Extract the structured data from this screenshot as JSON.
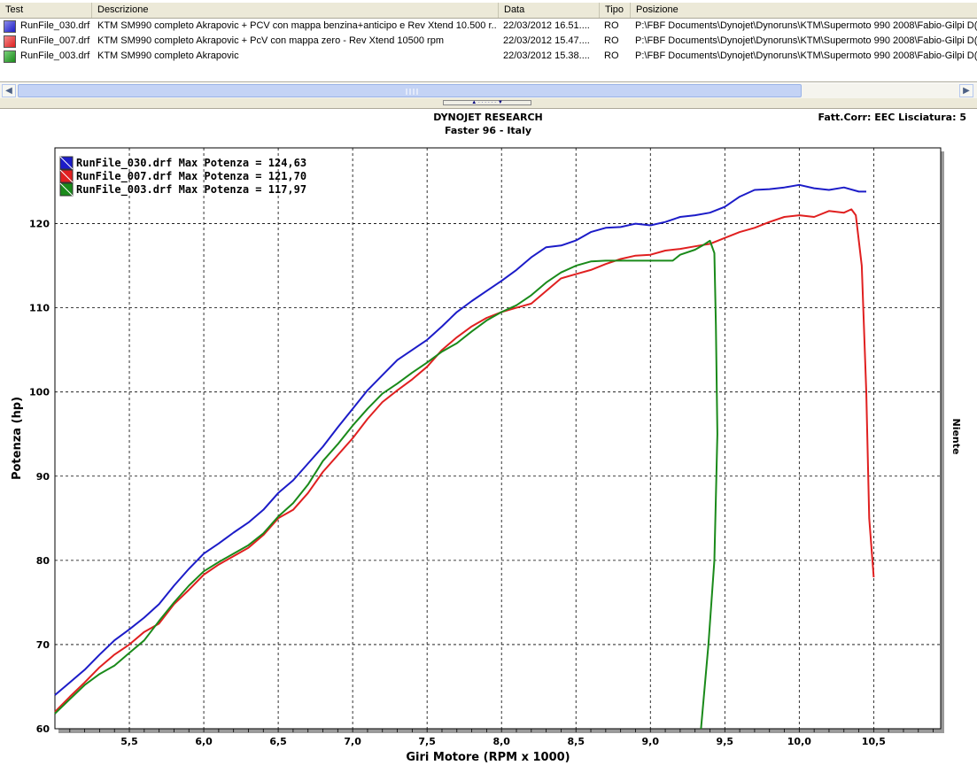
{
  "table": {
    "columns": [
      "Test",
      "Descrizione",
      "Data",
      "Tipo",
      "Posizione"
    ],
    "rows": [
      {
        "test": "RunFile_030.drf",
        "descrizione": "KTM SM990 completo Akrapovic + PCV con mappa benzina+anticipo e Rev Xtend 10.500 r...",
        "data": "22/03/2012 16.51....",
        "tipo": "RO",
        "posizione": "P:\\FBF Documents\\Dynojet\\Dynoruns\\KTM\\Supermoto 990 2008\\Fabio-Gilpi D(",
        "color": "#1c1cc8"
      },
      {
        "test": "RunFile_007.drf",
        "descrizione": "KTM SM990 completo Akrapovic + PcV con mappa zero - Rev Xtend 10500 rpm",
        "data": "22/03/2012 15.47....",
        "tipo": "RO",
        "posizione": "P:\\FBF Documents\\Dynojet\\Dynoruns\\KTM\\Supermoto 990 2008\\Fabio-Gilpi D(",
        "color": "#e02020"
      },
      {
        "test": "RunFile_003.drf",
        "descrizione": "KTM SM990 completo Akrapovic",
        "data": "22/03/2012 15.38....",
        "tipo": "RO",
        "posizione": "P:\\FBF Documents\\Dynojet\\Dynoruns\\KTM\\Supermoto 990 2008\\Fabio-Gilpi D(",
        "color": "#1a8a1a"
      }
    ]
  },
  "scrollbar": {
    "left_icon": "chevron-left-icon",
    "right_icon": "chevron-right-icon"
  },
  "graph": {
    "title_line1": "DYNOJET RESEARCH",
    "title_line2": "Faster 96 - Italy",
    "corr_label": "Fatt.Corr: EEC  Lisciatura: 5",
    "right_label": "Niente"
  },
  "chart_data": {
    "type": "line",
    "xlabel": "Giri Motore (RPM x 1000)",
    "ylabel": "Potenza (hp)",
    "xlim": [
      5.0,
      10.95
    ],
    "ylim": [
      60,
      129
    ],
    "xticks": [
      "5,5",
      "6,0",
      "6,5",
      "7,0",
      "7,5",
      "8,0",
      "8,5",
      "9,0",
      "9,5",
      "10,0",
      "10,5"
    ],
    "xtick_values": [
      5.5,
      6.0,
      6.5,
      7.0,
      7.5,
      8.0,
      8.5,
      9.0,
      9.5,
      10.0,
      10.5
    ],
    "yticks": [
      "60",
      "70",
      "80",
      "90",
      "100",
      "110",
      "120"
    ],
    "ytick_values": [
      60,
      70,
      80,
      90,
      100,
      110,
      120
    ],
    "grid": true,
    "legend_position": "top-left",
    "series": [
      {
        "name": "RunFile_030.drf",
        "legend": "RunFile_030.drf Max Potenza = 124,63",
        "color": "#1c1cc8",
        "points": [
          [
            5.0,
            64.0
          ],
          [
            5.1,
            65.5
          ],
          [
            5.2,
            67.0
          ],
          [
            5.3,
            68.8
          ],
          [
            5.4,
            70.5
          ],
          [
            5.5,
            71.8
          ],
          [
            5.6,
            73.2
          ],
          [
            5.7,
            74.8
          ],
          [
            5.8,
            77.0
          ],
          [
            5.9,
            79.0
          ],
          [
            6.0,
            80.8
          ],
          [
            6.1,
            82.0
          ],
          [
            6.2,
            83.3
          ],
          [
            6.3,
            84.5
          ],
          [
            6.4,
            86.0
          ],
          [
            6.5,
            88.0
          ],
          [
            6.6,
            89.5
          ],
          [
            6.7,
            91.5
          ],
          [
            6.8,
            93.5
          ],
          [
            6.9,
            95.8
          ],
          [
            7.0,
            98.0
          ],
          [
            7.1,
            100.2
          ],
          [
            7.2,
            102.0
          ],
          [
            7.3,
            103.8
          ],
          [
            7.4,
            105.0
          ],
          [
            7.5,
            106.2
          ],
          [
            7.6,
            107.8
          ],
          [
            7.7,
            109.5
          ],
          [
            7.8,
            110.8
          ],
          [
            7.9,
            112.0
          ],
          [
            8.0,
            113.2
          ],
          [
            8.1,
            114.5
          ],
          [
            8.2,
            116.0
          ],
          [
            8.3,
            117.2
          ],
          [
            8.4,
            117.4
          ],
          [
            8.5,
            118.0
          ],
          [
            8.6,
            119.0
          ],
          [
            8.7,
            119.5
          ],
          [
            8.8,
            119.6
          ],
          [
            8.9,
            120.0
          ],
          [
            9.0,
            119.8
          ],
          [
            9.1,
            120.2
          ],
          [
            9.2,
            120.8
          ],
          [
            9.3,
            121.0
          ],
          [
            9.4,
            121.3
          ],
          [
            9.5,
            122.0
          ],
          [
            9.6,
            123.2
          ],
          [
            9.7,
            124.0
          ],
          [
            9.8,
            124.1
          ],
          [
            9.9,
            124.3
          ],
          [
            10.0,
            124.6
          ],
          [
            10.1,
            124.2
          ],
          [
            10.2,
            124.0
          ],
          [
            10.3,
            124.3
          ],
          [
            10.4,
            123.8
          ],
          [
            10.45,
            123.8
          ]
        ]
      },
      {
        "name": "RunFile_007.drf",
        "legend": "RunFile_007.drf Max Potenza = 121,70",
        "color": "#e02020",
        "points": [
          [
            5.0,
            62.0
          ],
          [
            5.1,
            63.8
          ],
          [
            5.2,
            65.5
          ],
          [
            5.3,
            67.3
          ],
          [
            5.4,
            68.8
          ],
          [
            5.5,
            70.0
          ],
          [
            5.6,
            71.5
          ],
          [
            5.7,
            72.5
          ],
          [
            5.8,
            74.8
          ],
          [
            5.9,
            76.5
          ],
          [
            6.0,
            78.3
          ],
          [
            6.1,
            79.5
          ],
          [
            6.2,
            80.5
          ],
          [
            6.3,
            81.5
          ],
          [
            6.4,
            83.0
          ],
          [
            6.5,
            85.0
          ],
          [
            6.6,
            86.0
          ],
          [
            6.7,
            88.0
          ],
          [
            6.8,
            90.5
          ],
          [
            6.9,
            92.5
          ],
          [
            7.0,
            94.5
          ],
          [
            7.1,
            96.8
          ],
          [
            7.2,
            98.8
          ],
          [
            7.3,
            100.2
          ],
          [
            7.4,
            101.5
          ],
          [
            7.5,
            103.0
          ],
          [
            7.6,
            105.0
          ],
          [
            7.7,
            106.5
          ],
          [
            7.8,
            107.8
          ],
          [
            7.9,
            108.8
          ],
          [
            8.0,
            109.5
          ],
          [
            8.1,
            110.0
          ],
          [
            8.2,
            110.5
          ],
          [
            8.3,
            112.0
          ],
          [
            8.4,
            113.5
          ],
          [
            8.5,
            114.0
          ],
          [
            8.6,
            114.5
          ],
          [
            8.7,
            115.2
          ],
          [
            8.8,
            115.8
          ],
          [
            8.9,
            116.2
          ],
          [
            9.0,
            116.3
          ],
          [
            9.1,
            116.8
          ],
          [
            9.2,
            117.0
          ],
          [
            9.3,
            117.3
          ],
          [
            9.4,
            117.6
          ],
          [
            9.5,
            118.3
          ],
          [
            9.6,
            119.0
          ],
          [
            9.7,
            119.5
          ],
          [
            9.8,
            120.2
          ],
          [
            9.9,
            120.8
          ],
          [
            10.0,
            121.0
          ],
          [
            10.1,
            120.8
          ],
          [
            10.2,
            121.5
          ],
          [
            10.3,
            121.3
          ],
          [
            10.35,
            121.7
          ],
          [
            10.38,
            121.0
          ],
          [
            10.42,
            115.0
          ],
          [
            10.45,
            100.0
          ],
          [
            10.47,
            85.0
          ],
          [
            10.5,
            78.0
          ]
        ]
      },
      {
        "name": "RunFile_003.drf",
        "legend": "RunFile_003.drf Max Potenza = 117,97",
        "color": "#1a8a1a",
        "points": [
          [
            5.0,
            61.8
          ],
          [
            5.1,
            63.5
          ],
          [
            5.2,
            65.2
          ],
          [
            5.3,
            66.5
          ],
          [
            5.4,
            67.5
          ],
          [
            5.5,
            69.0
          ],
          [
            5.6,
            70.5
          ],
          [
            5.7,
            72.8
          ],
          [
            5.8,
            75.0
          ],
          [
            5.9,
            77.0
          ],
          [
            6.0,
            78.7
          ],
          [
            6.1,
            79.8
          ],
          [
            6.2,
            80.8
          ],
          [
            6.3,
            81.8
          ],
          [
            6.4,
            83.2
          ],
          [
            6.5,
            85.2
          ],
          [
            6.6,
            86.8
          ],
          [
            6.7,
            89.0
          ],
          [
            6.8,
            91.8
          ],
          [
            6.9,
            93.8
          ],
          [
            7.0,
            96.0
          ],
          [
            7.1,
            98.0
          ],
          [
            7.2,
            99.8
          ],
          [
            7.3,
            101.0
          ],
          [
            7.4,
            102.3
          ],
          [
            7.5,
            103.5
          ],
          [
            7.6,
            104.8
          ],
          [
            7.7,
            105.8
          ],
          [
            7.8,
            107.2
          ],
          [
            7.9,
            108.5
          ],
          [
            8.0,
            109.5
          ],
          [
            8.1,
            110.3
          ],
          [
            8.2,
            111.5
          ],
          [
            8.3,
            113.0
          ],
          [
            8.4,
            114.2
          ],
          [
            8.5,
            115.0
          ],
          [
            8.6,
            115.5
          ],
          [
            8.7,
            115.6
          ],
          [
            8.8,
            115.6
          ],
          [
            8.9,
            115.6
          ],
          [
            9.0,
            115.6
          ],
          [
            9.1,
            115.6
          ],
          [
            9.15,
            115.6
          ],
          [
            9.2,
            116.3
          ],
          [
            9.3,
            116.9
          ],
          [
            9.35,
            117.4
          ],
          [
            9.4,
            117.97
          ],
          [
            9.43,
            116.5
          ],
          [
            9.44,
            108.0
          ],
          [
            9.45,
            95.0
          ],
          [
            9.43,
            80.0
          ],
          [
            9.39,
            70.0
          ],
          [
            9.34,
            60.0
          ]
        ]
      }
    ]
  }
}
